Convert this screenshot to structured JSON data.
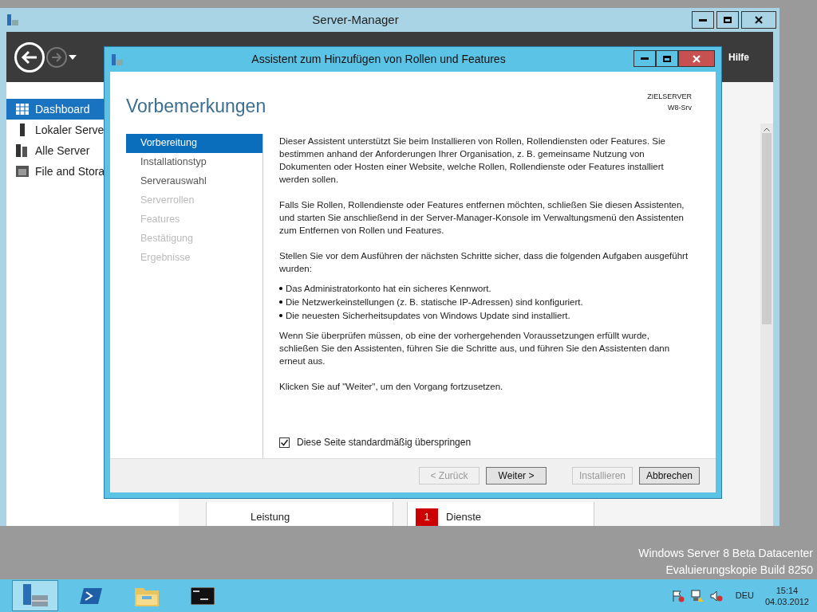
{
  "server_manager": {
    "title": "Server-Manager",
    "menu": "Hilfe",
    "nav": [
      {
        "kind": "dashboard",
        "label": "Dashboard",
        "selected": true
      },
      {
        "kind": "server",
        "label": "Lokaler Serve",
        "selected": false
      },
      {
        "kind": "servers",
        "label": "Alle Server",
        "selected": false
      },
      {
        "kind": "storage",
        "label": "File and Stora",
        "selected": false
      }
    ],
    "tiles": [
      {
        "label": "Leistung"
      },
      {
        "badge": "1",
        "label": "Dienste"
      }
    ]
  },
  "wizard": {
    "title": "Assistent zum Hinzufügen von Rollen und Features",
    "heading": "Vorbemerkungen",
    "target_label": "ZIELSERVER",
    "target_name": "W8-Srv",
    "steps": [
      {
        "label": "Vorbereitung",
        "selected": true,
        "disabled": false
      },
      {
        "label": "Installationstyp",
        "selected": false,
        "disabled": false
      },
      {
        "label": "Serverauswahl",
        "selected": false,
        "disabled": false
      },
      {
        "label": "Serverrollen",
        "selected": false,
        "disabled": true
      },
      {
        "label": "Features",
        "selected": false,
        "disabled": true
      },
      {
        "label": "Bestätigung",
        "selected": false,
        "disabled": true
      },
      {
        "label": "Ergebnisse",
        "selected": false,
        "disabled": true
      }
    ],
    "content": [
      {
        "kind": "paragraph",
        "text": "Dieser Assistent unterstützt Sie beim Installieren von Rollen, Rollendiensten oder Features. Sie bestimmen anhand der Anforderungen Ihrer Organisation, z. B. gemeinsame Nutzung von Dokumenten oder Hosten einer Website, welche Rollen, Rollendienste oder Features installiert werden sollen."
      },
      {
        "kind": "paragraph",
        "text": "Falls Sie Rollen, Rollendienste oder Features entfernen möchten, schließen Sie diesen Assistenten, und starten Sie anschließend in der Server-Manager-Konsole im Verwaltungsmenü den Assistenten zum Entfernen von Rollen und Features."
      },
      {
        "kind": "paragraph",
        "text": "Stellen Sie vor dem Ausführen der nächsten Schritte sicher, dass die folgenden Aufgaben ausgeführt wurden:"
      },
      {
        "kind": "bullets",
        "items": [
          "Das Administratorkonto hat ein sicheres Kennwort.",
          "Die Netzwerkeinstellungen (z. B. statische IP-Adressen) sind konfiguriert.",
          "Die neuesten Sicherheitsupdates von Windows Update sind installiert."
        ]
      },
      {
        "kind": "paragraph",
        "text": "Wenn Sie überprüfen müssen, ob eine der vorhergehenden Voraussetzungen erfüllt wurde, schließen Sie den Assistenten, führen Sie die Schritte aus, und führen Sie den Assistenten dann erneut aus."
      },
      {
        "kind": "paragraph",
        "text": "Klicken Sie auf \"Weiter\", um den Vorgang fortzusetzen."
      }
    ],
    "skip": {
      "label": "Diese Seite standardmäßig überspringen",
      "checked": true
    },
    "buttons": [
      {
        "label": "< Zurück",
        "disabled": true
      },
      {
        "label": "Weiter >",
        "disabled": false
      },
      {
        "label": "Installieren",
        "disabled": true
      },
      {
        "label": "Abbrechen",
        "disabled": false
      }
    ]
  },
  "desktop": {
    "edition": [
      "Windows Server 8 Beta Datacenter",
      "Evaluierungskopie Build 8250"
    ]
  },
  "taskbar": {
    "apps": [
      {
        "kind": "server-manager",
        "selected": true
      },
      {
        "kind": "powershell",
        "selected": false
      },
      {
        "kind": "explorer",
        "selected": false
      },
      {
        "kind": "console",
        "selected": false
      }
    ],
    "tray": [
      {
        "kind": "flag"
      },
      {
        "kind": "network"
      },
      {
        "kind": "sound"
      }
    ],
    "language": "DEU",
    "time": "15:14",
    "date": "04.03.2012"
  }
}
